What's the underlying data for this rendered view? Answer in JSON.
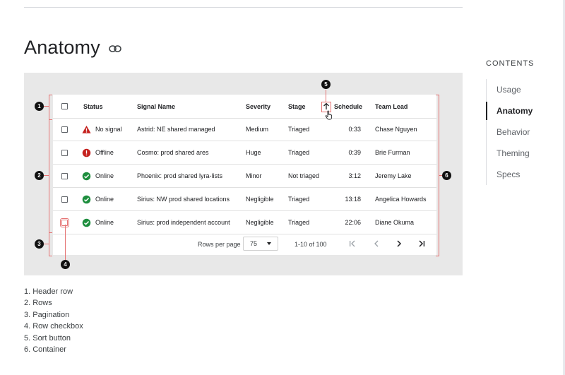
{
  "page": {
    "title": "Anatomy"
  },
  "toc": {
    "heading": "CONTENTS",
    "items": [
      {
        "label": "Usage",
        "active": false
      },
      {
        "label": "Anatomy",
        "active": true
      },
      {
        "label": "Behavior",
        "active": false
      },
      {
        "label": "Theming",
        "active": false
      },
      {
        "label": "Specs",
        "active": false
      }
    ]
  },
  "table": {
    "columns": {
      "status": "Status",
      "signal": "Signal Name",
      "severity": "Severity",
      "stage": "Stage",
      "schedule": "Schedule",
      "lead": "Team Lead"
    },
    "rows": [
      {
        "status": "No signal",
        "status_icon": "warning-icon",
        "signal": "Astrid: NE shared managed",
        "severity": "Medium",
        "stage": "Triaged",
        "schedule": "0:33",
        "lead": "Chase Nguyen"
      },
      {
        "status": "Offline",
        "status_icon": "error-icon",
        "signal": "Cosmo: prod shared ares",
        "severity": "Huge",
        "stage": "Triaged",
        "schedule": "0:39",
        "lead": "Brie Furman"
      },
      {
        "status": "Online",
        "status_icon": "check-circle-icon",
        "signal": "Phoenix: prod shared lyra-lists",
        "severity": "Minor",
        "stage": "Not triaged",
        "schedule": "3:12",
        "lead": "Jeremy Lake"
      },
      {
        "status": "Online",
        "status_icon": "check-circle-icon",
        "signal": "Sirius: NW prod shared locations",
        "severity": "Negligible",
        "stage": "Triaged",
        "schedule": "13:18",
        "lead": "Angelica Howards"
      },
      {
        "status": "Online",
        "status_icon": "check-circle-icon",
        "signal": "Sirius: prod independent account",
        "severity": "Negligible",
        "stage": "Triaged",
        "schedule": "22:06",
        "lead": "Diane Okuma"
      }
    ],
    "pagination": {
      "rows_per_page_label": "Rows per page",
      "rows_per_page": "75",
      "range": "1-10 of 100"
    }
  },
  "annotations": {
    "markers": [
      "1",
      "2",
      "3",
      "4",
      "5",
      "6"
    ],
    "legend": [
      "1. Header row",
      "2. Rows",
      "3. Pagination",
      "4. Row checkbox",
      "5. Sort button",
      "6. Container"
    ]
  },
  "colors": {
    "warning": "#c5221f",
    "error": "#c5221f",
    "success": "#1e8e3e",
    "annotation": "#e57373"
  }
}
